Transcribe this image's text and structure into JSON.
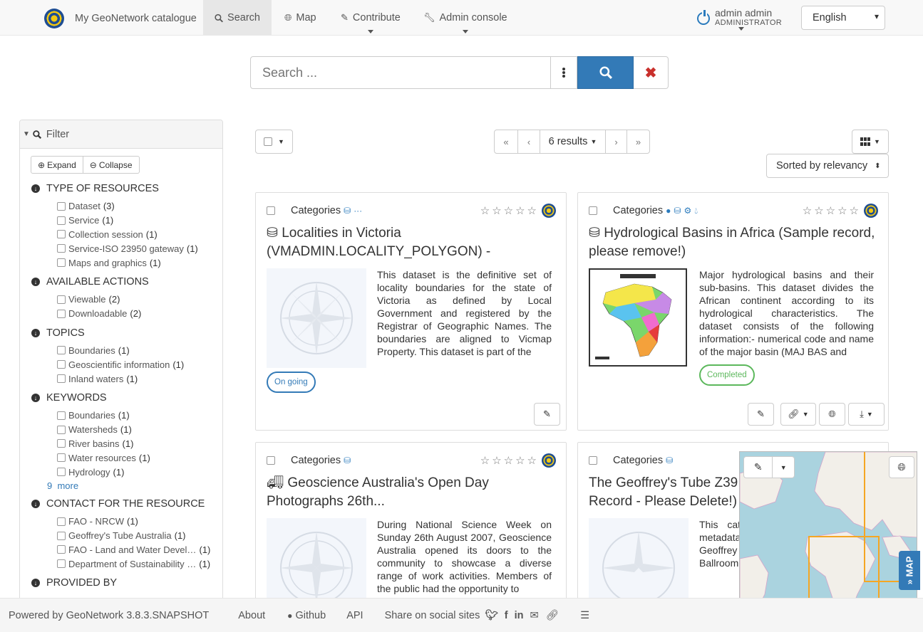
{
  "nav": {
    "brand": "My GeoNetwork catalogue",
    "items": [
      {
        "label": "Search",
        "icon": "search-icon"
      },
      {
        "label": "Map",
        "icon": "globe-icon"
      },
      {
        "label": "Contribute",
        "icon": "pencil-icon"
      },
      {
        "label": "Admin console",
        "icon": "wrench-icon"
      }
    ],
    "user_name": "admin admin",
    "user_role": "ADMINISTRATOR",
    "language": "English"
  },
  "search": {
    "placeholder": "Search ..."
  },
  "filter": {
    "title": "Filter",
    "expand": "Expand",
    "collapse": "Collapse",
    "sections": [
      {
        "title": "TYPE OF RESOURCES",
        "items": [
          {
            "label": "Dataset",
            "count": "(3)"
          },
          {
            "label": "Service",
            "count": "(1)"
          },
          {
            "label": "Collection session",
            "count": "(1)"
          },
          {
            "label": "Service-ISO 23950 gateway",
            "count": "(1)"
          },
          {
            "label": "Maps and graphics",
            "count": "(1)"
          }
        ]
      },
      {
        "title": "AVAILABLE ACTIONS",
        "items": [
          {
            "label": "Viewable",
            "count": "(2)"
          },
          {
            "label": "Downloadable",
            "count": "(2)"
          }
        ]
      },
      {
        "title": "TOPICS",
        "items": [
          {
            "label": "Boundaries",
            "count": "(1)"
          },
          {
            "label": "Geoscientific information",
            "count": "(1)"
          },
          {
            "label": "Inland waters",
            "count": "(1)"
          }
        ]
      },
      {
        "title": "KEYWORDS",
        "items": [
          {
            "label": "Boundaries",
            "count": "(1)"
          },
          {
            "label": "Watersheds",
            "count": "(1)"
          },
          {
            "label": "River basins",
            "count": "(1)"
          },
          {
            "label": "Water resources",
            "count": "(1)"
          },
          {
            "label": "Hydrology",
            "count": "(1)"
          }
        ],
        "more_count": "9",
        "more_label": "more"
      },
      {
        "title": "CONTACT FOR THE RESOURCE",
        "items": [
          {
            "label": "FAO - NRCW",
            "count": "(1)"
          },
          {
            "label": "Geoffrey's Tube Australia",
            "count": "(1)"
          },
          {
            "label": "FAO - Land and Water Devel…",
            "count": "(1)"
          },
          {
            "label": "Department of Sustainability …",
            "count": "(1)"
          }
        ]
      },
      {
        "title": "PROVIDED BY",
        "items": []
      }
    ]
  },
  "results": {
    "count_label": "6 results",
    "sort_label": "Sorted by relevancy",
    "cards": [
      {
        "categories": "Categories",
        "title": "Localities in Victoria (VMADMIN.LOCALITY_POLYGON) -",
        "abstract": "This dataset is the definitive set of locality boundaries for the state of Victoria as defined by Local Government and registered by the Registrar of Geographic Names. The boundaries are aligned to Vicmap Property. This dataset is part of the",
        "status": "On going"
      },
      {
        "categories": "Categories",
        "title": "Hydrological Basins in Africa (Sample record, please remove!)",
        "abstract": "Major hydrological basins and their sub-basins. This dataset divides the African continent according to its hydrological characteristics. The dataset consists of the following information:- numerical code and name of the major basin (MAJ BAS and",
        "status": "Completed"
      },
      {
        "categories": "Categories",
        "title": "Geoscience Australia's Open Day Photographs 26th...",
        "abstract": "During National Science Week on Sunday 26th August 2007, Geoscience Australia opened its doors to the community to showcase a diverse range of work activities. Members of the public had the opportunity to"
      },
      {
        "categories": "Categories",
        "title": "The Geoffrey's Tube Z39 Record - Please Delete!)",
        "abstract": "This cat metadata Geoffrey Ballroom."
      }
    ]
  },
  "map": {
    "tab_label": "MAP",
    "info": "i"
  },
  "footer": {
    "powered": "Powered by GeoNetwork 3.8.3.SNAPSHOT",
    "about": "About",
    "github": "Github",
    "api": "API",
    "share": "Share on social sites"
  },
  "colors": {
    "primary": "#337ab7",
    "danger": "#c9302c",
    "success": "#5cb85c"
  }
}
